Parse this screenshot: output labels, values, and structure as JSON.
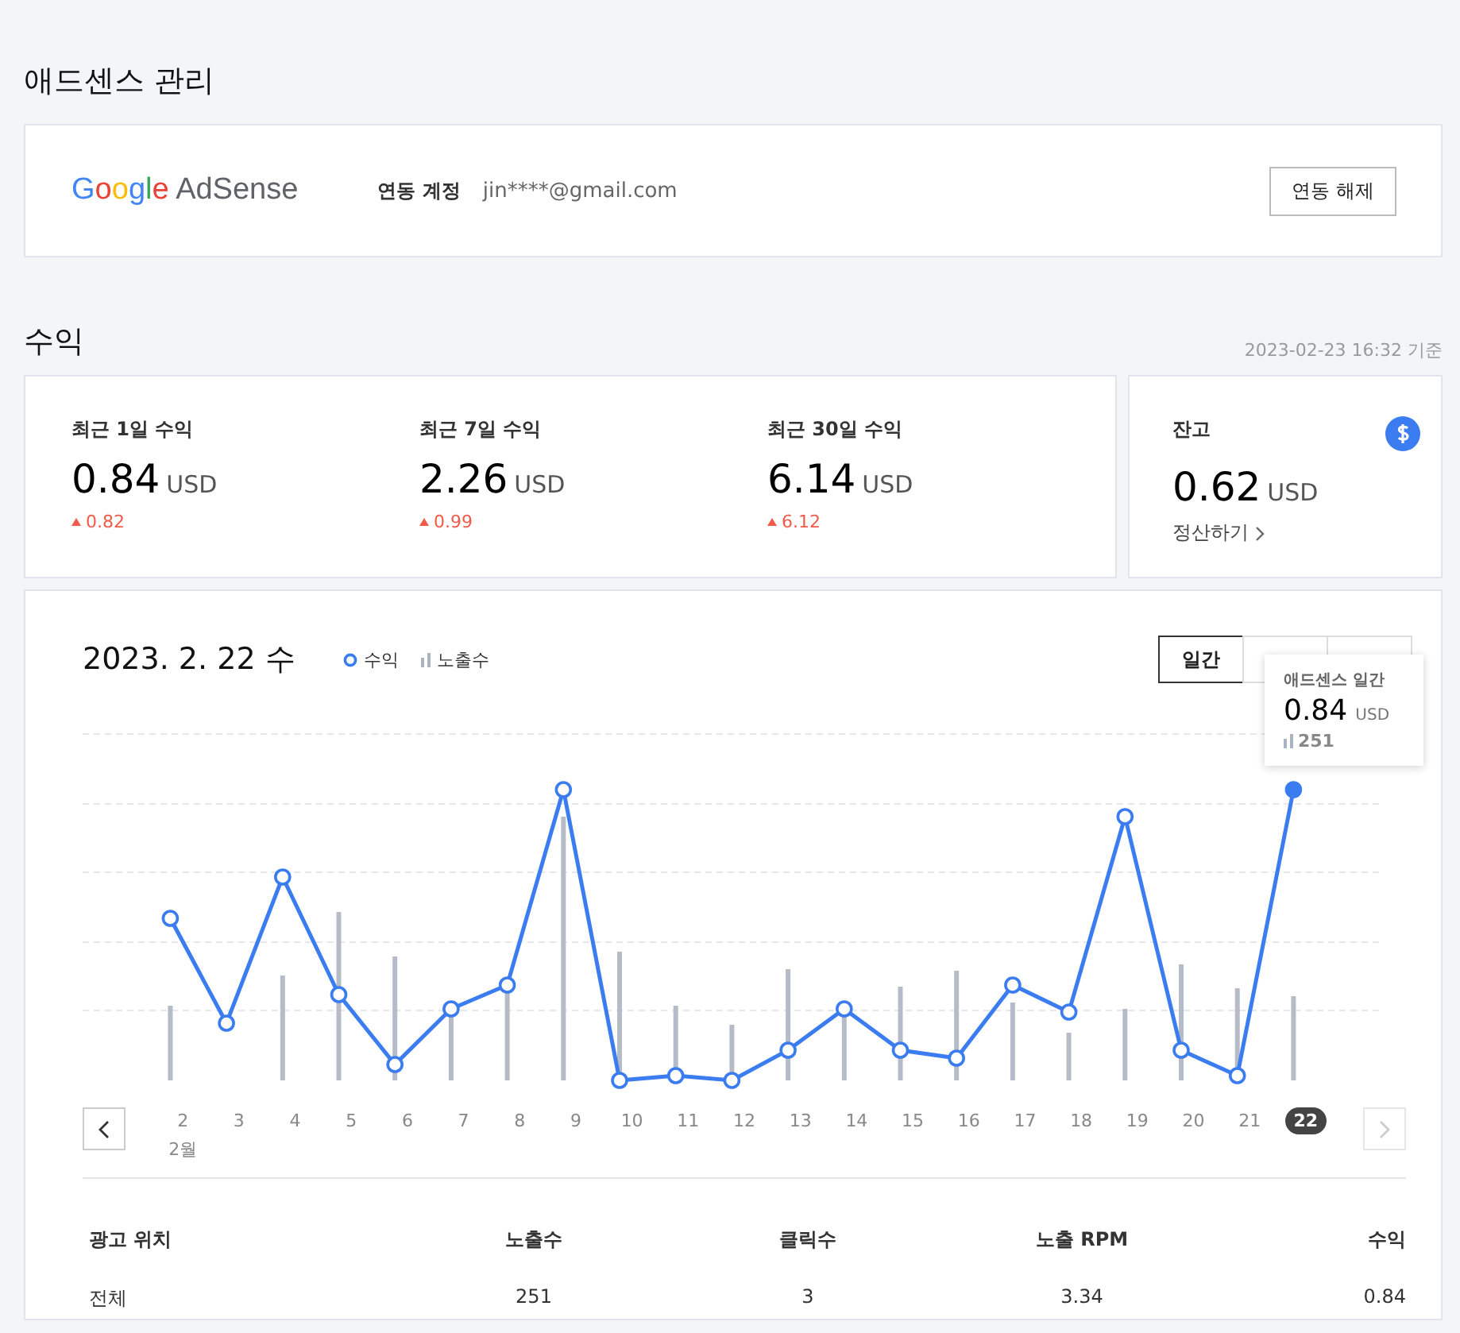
{
  "page_title": "애드센스 관리",
  "logo": {
    "brand": "Google",
    "product": "AdSense"
  },
  "account": {
    "label": "연동 계정",
    "email": "jin****@gmail.com",
    "button": "연동 해제"
  },
  "earnings": {
    "title": "수익",
    "timestamp": "2023-02-23 16:32 기준",
    "summary": [
      {
        "label": "최근 1일 수익",
        "value": "0.84",
        "unit": "USD",
        "change": "0.82"
      },
      {
        "label": "최근 7일 수익",
        "value": "2.26",
        "unit": "USD",
        "change": "0.99"
      },
      {
        "label": "최근 30일 수익",
        "value": "6.14",
        "unit": "USD",
        "change": "6.12"
      }
    ],
    "balance": {
      "label": "잔고",
      "value": "0.62",
      "unit": "USD",
      "link": "정산하기"
    }
  },
  "chart": {
    "date": "2023. 2. 22 수",
    "legend": [
      {
        "kind": "line",
        "label": "수익"
      },
      {
        "kind": "bar",
        "label": "노출수"
      }
    ],
    "tabs": [
      {
        "label": "일간",
        "selected": true
      },
      {
        "selected": false
      },
      {
        "selected": false
      }
    ],
    "tooltip": {
      "title": "애드센스 일간",
      "value": "0.84",
      "unit": "USD",
      "impressions": "251"
    },
    "month_label": "2월",
    "days": [
      {
        "label": "2",
        "selected": false
      },
      {
        "label": "3",
        "selected": false
      },
      {
        "label": "4",
        "selected": false
      },
      {
        "label": "5",
        "selected": false
      },
      {
        "label": "6",
        "selected": false
      },
      {
        "label": "7",
        "selected": false
      },
      {
        "label": "8",
        "selected": false
      },
      {
        "label": "9",
        "selected": false
      },
      {
        "label": "10",
        "selected": false
      },
      {
        "label": "11",
        "selected": false
      },
      {
        "label": "12",
        "selected": false
      },
      {
        "label": "13",
        "selected": false
      },
      {
        "label": "14",
        "selected": false
      },
      {
        "label": "15",
        "selected": false
      },
      {
        "label": "16",
        "selected": false
      },
      {
        "label": "17",
        "selected": false
      },
      {
        "label": "18",
        "selected": false
      },
      {
        "label": "19",
        "selected": false
      },
      {
        "label": "20",
        "selected": false
      },
      {
        "label": "21",
        "selected": false
      },
      {
        "label": "22",
        "selected": true
      }
    ]
  },
  "table": {
    "columns": [
      "광고 위치",
      "노출수",
      "클릭수",
      "노출 RPM",
      "수익"
    ],
    "rows": [
      [
        "전체",
        "251",
        "3",
        "3.34",
        "0.84"
      ]
    ]
  }
}
